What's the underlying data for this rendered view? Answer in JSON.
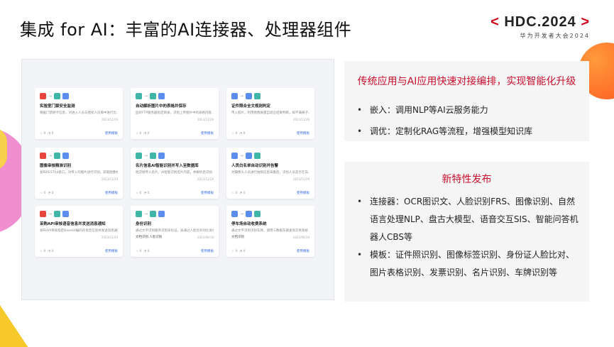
{
  "title": "集成 for AI：丰富的AI连接器、处理器组件",
  "logo": {
    "bracket_left": "<",
    "main": "HDC.2024",
    "bracket_right": ">",
    "sub": "华为开发者大会2024"
  },
  "cards": [
    {
      "title": "实验室门禁安全监测",
      "desc": "根据门禁刷卡信息，对进入人员与授权人员库中进行比...",
      "date": "2023/12/29",
      "tag": "",
      "likes": "0",
      "views": "0",
      "link": "使用模板"
    },
    {
      "title": "自动解析图片中的表格并保存",
      "desc": "监听FTP服务器指定目录，识别上传图片中的表格内容...",
      "date": "2023/12/29",
      "tag": "",
      "likes": "0",
      "views": "0",
      "link": "使用模板"
    },
    {
      "title": "证件照合全文规则判定",
      "desc": "传入照片，利用图像质量自适应结果判断，如不满眼子、人...",
      "date": "2023/12/29",
      "tag": "",
      "likes": "0",
      "views": "0",
      "link": "使用模板"
    },
    {
      "title": "图像审核精准识别",
      "desc": "发布RESTful接口，对传入的图片进行识别，获取图像标...",
      "date": "2023/12/29",
      "tag": "",
      "likes": "0",
      "views": "0",
      "link": "使用模板"
    },
    {
      "title": "名片信息AI智能识别并写入至数据库",
      "desc": "批次接传入名片，AI智能识别名片内容，并解析后识别...",
      "date": "2023/12/29",
      "tag": "",
      "likes": "0",
      "views": "0",
      "link": "使用模板"
    },
    {
      "title": "人员白名单自动识别并告警",
      "desc": "对摄像头人员进行拍照信息采集后，识别人员是否在白...",
      "date": "2023/12/29",
      "tag": "",
      "likes": "0",
      "views": "0",
      "link": "使用模板"
    },
    {
      "title": "采购APi审核语音信息并发送消息通知",
      "desc": "发布API审核指定Base64编码的语音信息并发送消息通知...",
      "date": "2023/12/29",
      "tag": "",
      "likes": "0",
      "views": "0",
      "link": "使用模板"
    },
    {
      "title": "身份识别",
      "desc": "通过文字识别服务识别身份证，再通过人脸比对对比身份...",
      "date": "2022/06/16",
      "tag": "文档识别  人脸识别",
      "likes": "0",
      "views": "0",
      "link": "使用模板"
    },
    {
      "title": "停车场自动收费系统",
      "desc": "通过文字识别识别车牌，调用三数据车辆查询交易系统...",
      "date": "2022/06/19",
      "tag": "文档识别",
      "likes": "0",
      "views": "0",
      "link": "使用模板"
    }
  ],
  "panel1": {
    "heading": "传统应用与AI应用快速对接编排，实现智能化升级",
    "bullets": [
      "嵌入：调用NLP等AI云服务能力",
      "调优：定制化RAG等流程，增强模型知识库"
    ]
  },
  "panel2": {
    "heading": "新特性发布",
    "bullets": [
      "连接器：OCR图识文、人脸识别FRS、图像识别、自然语言处理NLP、盘古大模型、语音交互SIS、智能问答机器人CBS等",
      "模板：证件照识别、图像标签识别、身份证人脸比对、图片表格识别、发票识别、名片识别、车牌识别等"
    ]
  },
  "colors": {
    "accent": "#c8102e",
    "link": "#3b6fe0",
    "panel_bg": "#f5f5f5"
  }
}
